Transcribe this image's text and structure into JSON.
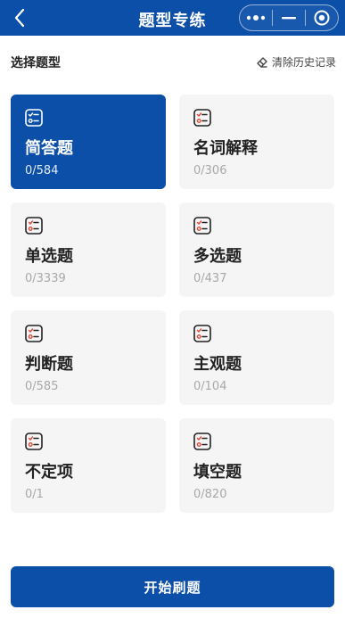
{
  "header": {
    "title": "题型专练",
    "back_icon": "chevron-left-icon",
    "capsule": [
      "more-dots-icon",
      "minimize-icon",
      "target-icon"
    ],
    "bg_color": "#0b4fa8"
  },
  "section": {
    "title": "选择题型",
    "clear_label": "清除历史记录",
    "clear_icon": "eraser-icon"
  },
  "question_types": [
    {
      "name": "简答题",
      "count": "0/584",
      "selected": true
    },
    {
      "name": "名词解释",
      "count": "0/306",
      "selected": false
    },
    {
      "name": "单选题",
      "count": "0/3339",
      "selected": false
    },
    {
      "name": "多选题",
      "count": "0/437",
      "selected": false
    },
    {
      "name": "判断题",
      "count": "0/585",
      "selected": false
    },
    {
      "name": "主观题",
      "count": "0/104",
      "selected": false
    },
    {
      "name": "不定项",
      "count": "0/1",
      "selected": false
    },
    {
      "name": "填空题",
      "count": "0/820",
      "selected": false
    },
    {
      "name": "",
      "count": "",
      "selected": false
    },
    {
      "name": "",
      "count": "",
      "selected": false
    }
  ],
  "start_button": {
    "label": "开始刷题"
  },
  "colors": {
    "accent": "#0b4fa8",
    "card_bg": "#f5f5f5",
    "muted": "#a8a8a8",
    "icon_red": "#e24b3b"
  }
}
